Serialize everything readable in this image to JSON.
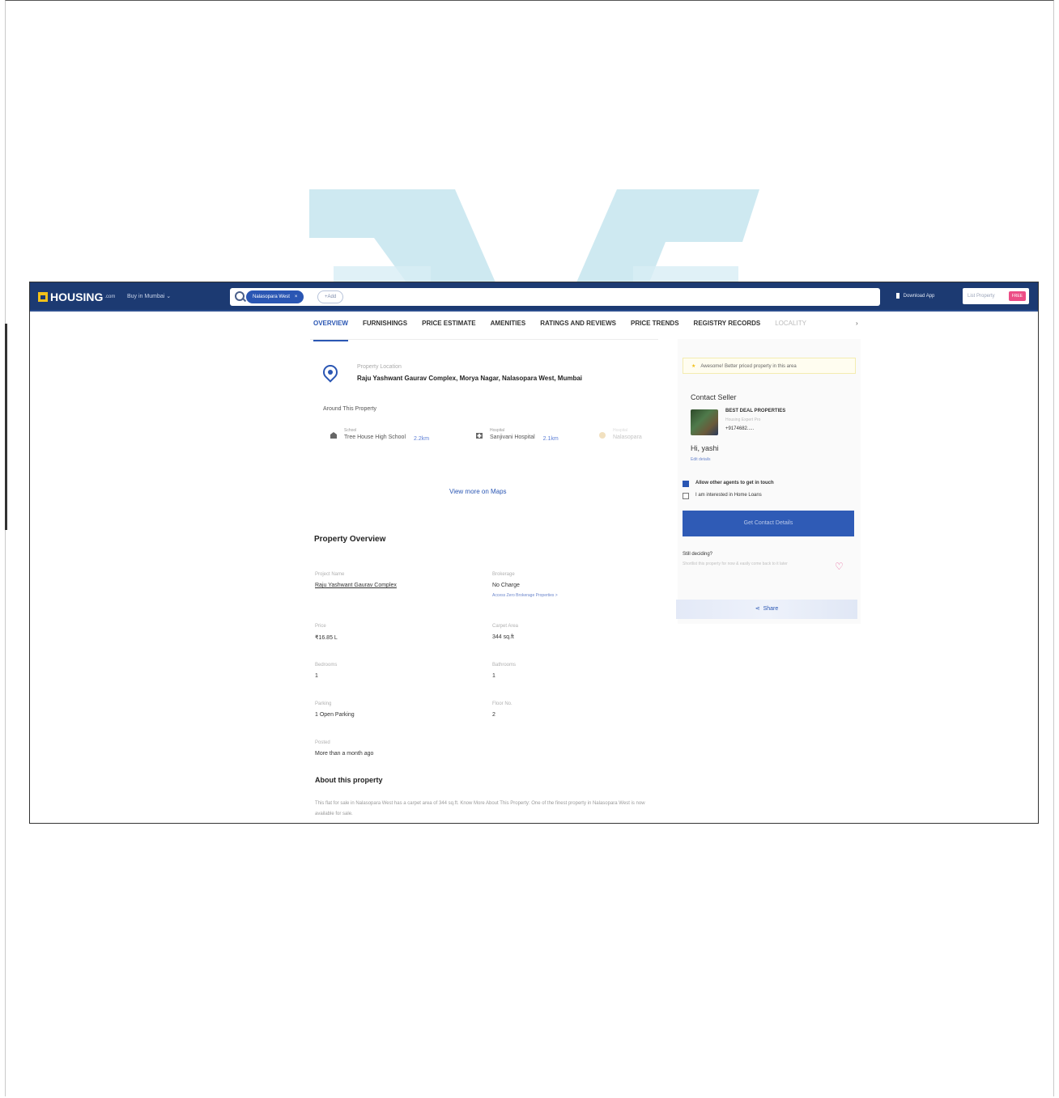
{
  "header": {
    "logo": "HOUSING",
    "logo_suffix": ".com",
    "city": "Buy in Mumbai",
    "search_chip": "Nalasopara West",
    "search_add": "+Add",
    "download_app": "Download App",
    "list_property": "List Property",
    "list_badge": "FREE"
  },
  "tabs": [
    "OVERVIEW",
    "FURNISHINGS",
    "PRICE ESTIMATE",
    "AMENITIES",
    "RATINGS AND REVIEWS",
    "PRICE TRENDS",
    "REGISTRY RECORDS",
    "LOCALITY"
  ],
  "location": {
    "label": "Property Location",
    "address": "Raju Yashwant Gaurav Complex, Morya Nagar, Nalasopara West, Mumbai"
  },
  "around": {
    "title": "Around This Property",
    "items": [
      {
        "category": "School",
        "name": "Tree House High School",
        "distance": "2.2km"
      },
      {
        "category": "Hospital",
        "name": "Sanjivani Hospital",
        "distance": "2.1km"
      },
      {
        "category": "Hospital",
        "name": "Nalasopara",
        "distance": ""
      }
    ],
    "view_more": "View more on Maps"
  },
  "overview": {
    "title": "Property Overview",
    "fields": [
      {
        "label": "Project Name",
        "value": "Raju Yashwant Gaurav Complex",
        "link": true
      },
      {
        "label": "Brokerage",
        "value": "No Charge",
        "sub": "Access Zero Brokerage Properties >"
      },
      {
        "label": "Price",
        "value": "₹16.85 L"
      },
      {
        "label": "Carpet Area",
        "value": "344 sq.ft"
      },
      {
        "label": "Bedrooms",
        "value": "1"
      },
      {
        "label": "Bathrooms",
        "value": "1"
      },
      {
        "label": "Parking",
        "value": "1 Open Parking"
      },
      {
        "label": "Floor No.",
        "value": "2"
      },
      {
        "label": "Posted",
        "value": "More than a month ago"
      }
    ]
  },
  "about": {
    "title": "About this property",
    "text": "This flat for sale in Nalasopara West has a carpet area of 344 sq.ft. Know More About This Property: One of the finest property in Nalasopara West is now available for sale."
  },
  "sidebar": {
    "promo": "Awesome! Better priced property in this area",
    "contact_title": "Contact Seller",
    "seller_name": "BEST DEAL PROPERTIES",
    "seller_sub": "Housing Expert Pro",
    "seller_phone": "+9174682.....",
    "greeting": "Hi, yashi",
    "edit_details": "Edit details",
    "check1": "Allow other agents to get in touch",
    "check2": "I am interested in Home Loans",
    "cta": "Get Contact Details",
    "still": "Still deciding?",
    "still_sub": "Shortlist this property for now & easily come back to it later",
    "share": "Share"
  }
}
